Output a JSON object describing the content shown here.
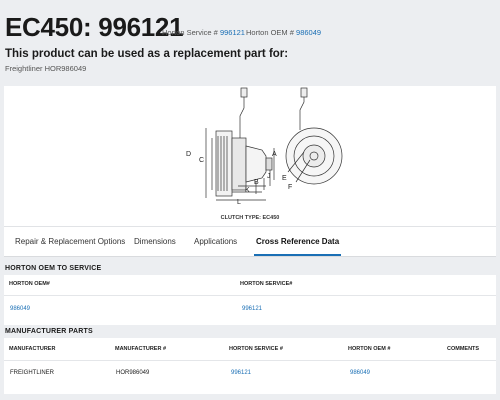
{
  "header": {
    "title": "EC450: 996121",
    "service_label": "Horton Service #",
    "service_value": "996121",
    "oem_label": "Horton OEM #",
    "oem_value": "986049",
    "subhead": "This product can be used as a replacement part for:",
    "subline": "Freightliner HOR986049"
  },
  "diagram": {
    "labels": {
      "A": "A",
      "B": "B",
      "C": "C",
      "D": "D",
      "E": "E",
      "F": "F",
      "J": "J",
      "K": "K",
      "L": "L"
    },
    "caption": "CLUTCH TYPE: EC450"
  },
  "tabs": [
    {
      "label": "Repair & Replacement Options"
    },
    {
      "label": "Dimensions"
    },
    {
      "label": "Applications"
    },
    {
      "label": "Cross Reference Data"
    }
  ],
  "oem_to_service": {
    "title": "HORTON OEM TO SERVICE",
    "headers": [
      "HORTON OEM#",
      "HORTON SERVICE#"
    ],
    "rows": [
      [
        "986049",
        "996121"
      ]
    ]
  },
  "manufacturer_parts": {
    "title": "MANUFACTURER PARTS",
    "headers": [
      "MANUFACTURER",
      "MANUFACTURER #",
      "HORTON SERVICE #",
      "HORTON OEM #",
      "COMMENTS"
    ],
    "rows": [
      [
        "FREIGHTLINER",
        "HOR986049",
        "996121",
        "986049",
        ""
      ]
    ]
  },
  "colors": {
    "link": "#1a6fb5",
    "page_bg": "#eceef1",
    "card_bg": "#ffffff"
  }
}
